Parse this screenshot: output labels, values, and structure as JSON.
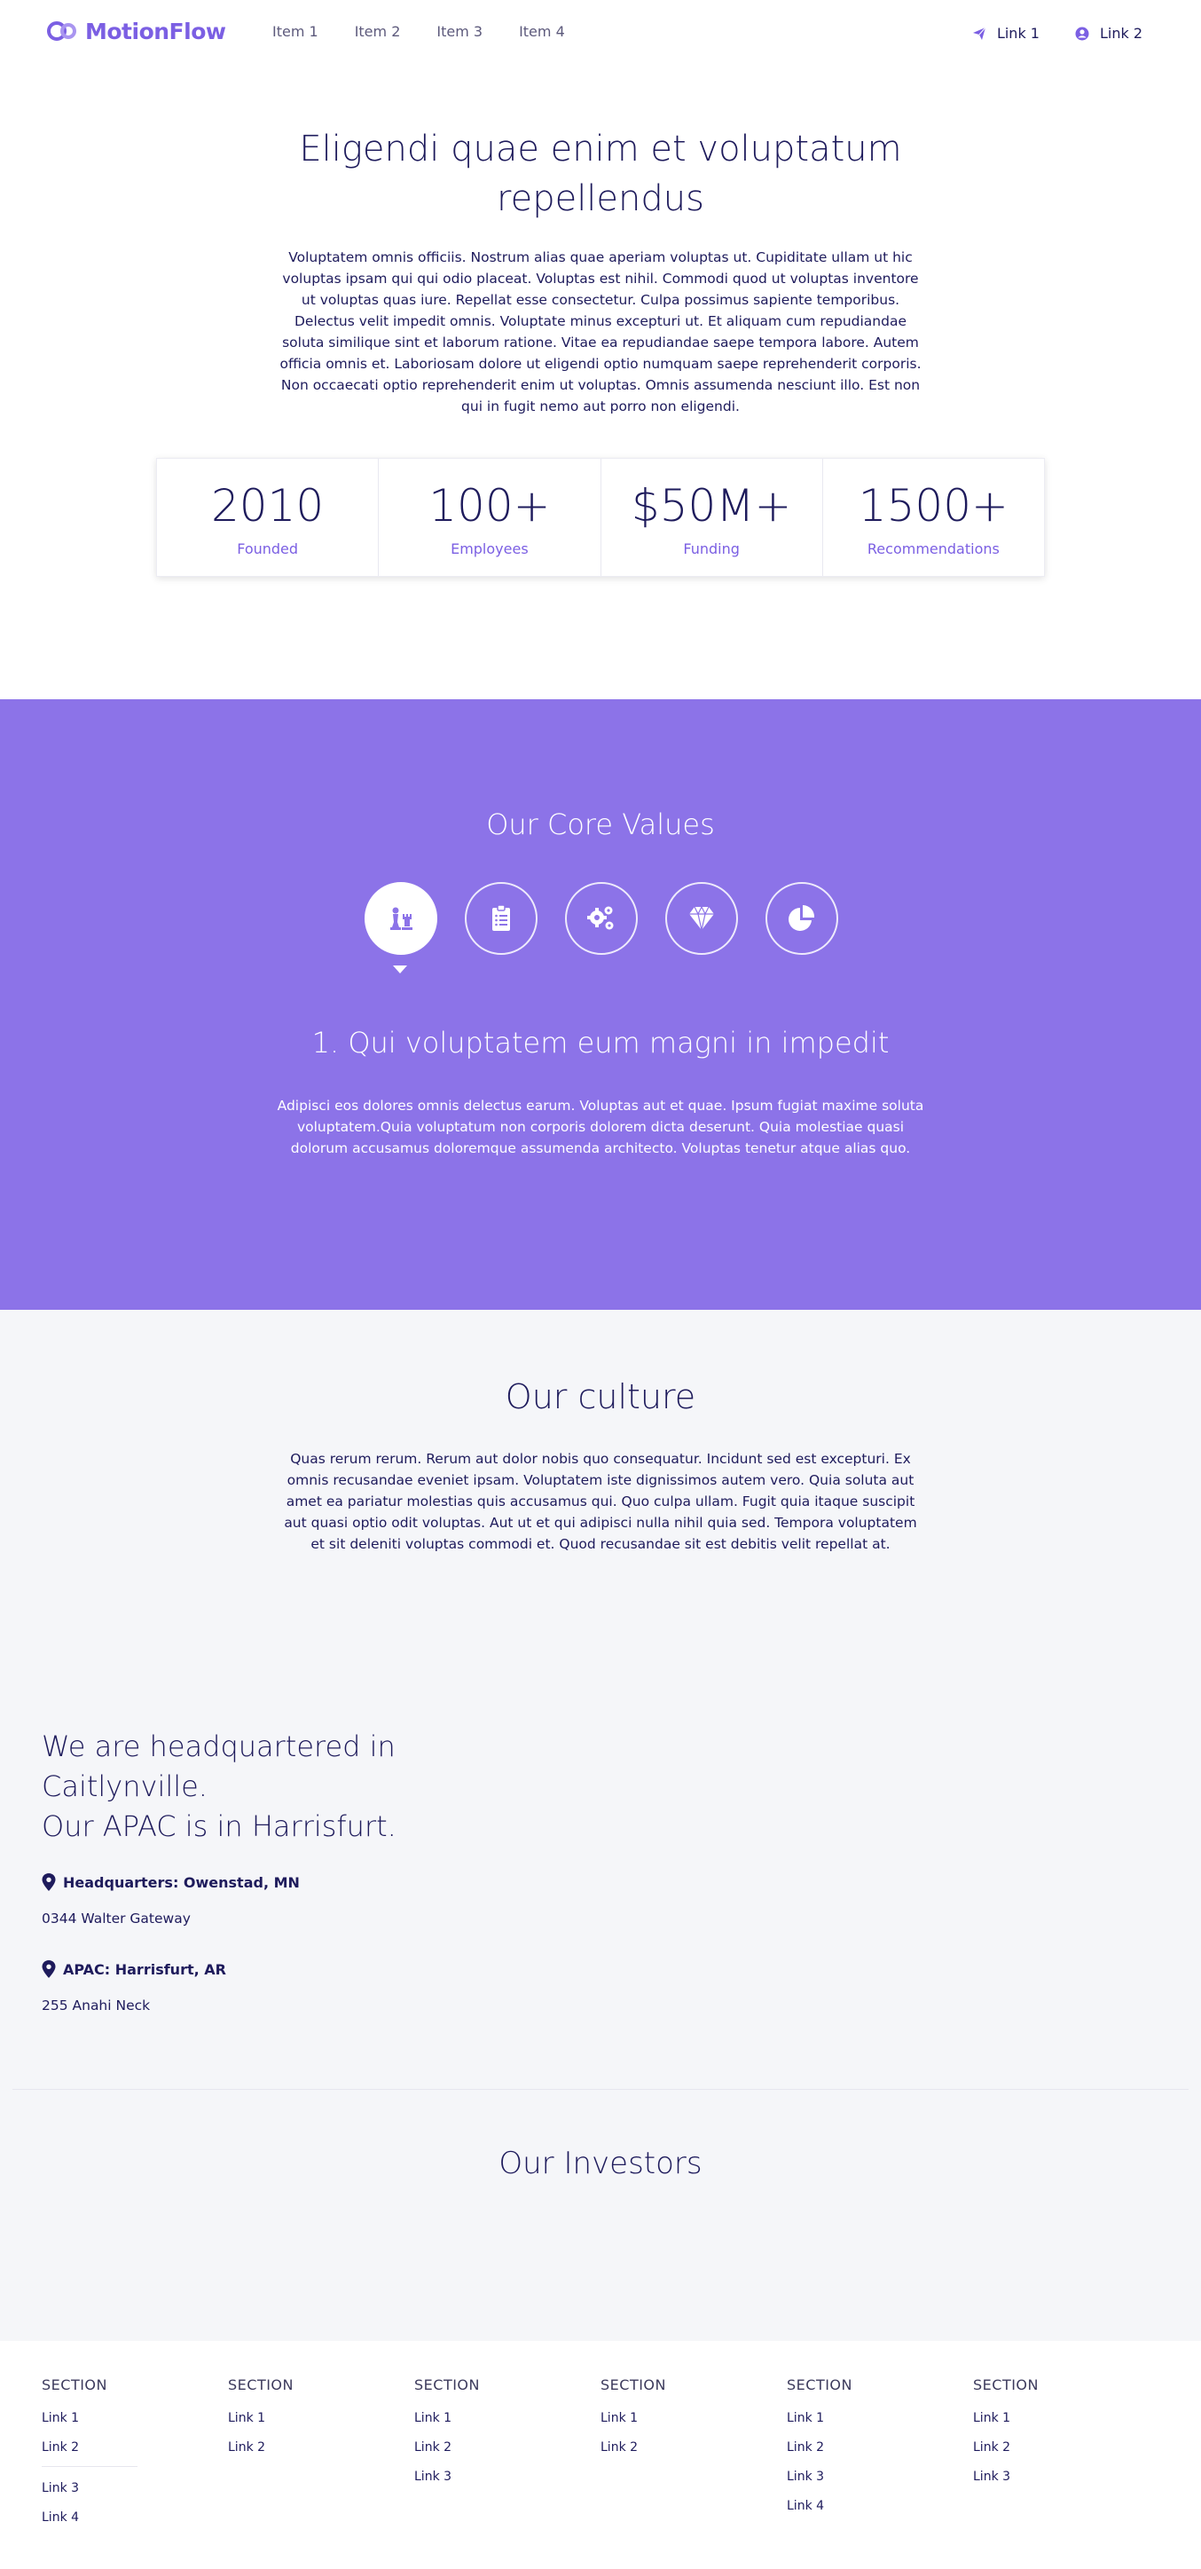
{
  "brand": {
    "name": "MotionFlow",
    "color": "#7b5fe3"
  },
  "nav": {
    "items": [
      "Item 1",
      "Item 2",
      "Item 3",
      "Item 4"
    ],
    "links": [
      {
        "label": "Link 1",
        "icon": "paper-plane-icon"
      },
      {
        "label": "Link 2",
        "icon": "user-circle-icon"
      }
    ]
  },
  "hero": {
    "title": "Eligendi quae enim et voluptatum repellendus",
    "text": "Voluptatem omnis officiis. Nostrum alias quae aperiam voluptas ut. Cupiditate ullam ut hic voluptas ipsam qui qui odio placeat. Voluptas est nihil. Commodi quod ut voluptas inventore ut voluptas quas iure. Repellat esse consectetur. Culpa possimus sapiente temporibus. Delectus velit impedit omnis. Voluptate minus excepturi ut. Et aliquam cum repudiandae soluta similique sint et laborum ratione. Vitae ea repudiandae saepe tempora labore. Autem officia omnis et. Laboriosam dolore ut eligendi optio numquam saepe reprehenderit corporis. Non occaecati optio reprehenderit enim ut voluptas. Omnis assumenda nesciunt illo. Est non qui in fugit nemo aut porro non eligendi."
  },
  "stats": [
    {
      "value": "2010",
      "label": "Founded"
    },
    {
      "value": "100+",
      "label": "Employees"
    },
    {
      "value": "$50M+",
      "label": "Funding"
    },
    {
      "value": "1500+",
      "label": "Recommendations"
    }
  ],
  "values": {
    "title": "Our Core Values",
    "background": "#8c73e8",
    "icons": [
      "chess-icon",
      "clipboard-list-icon",
      "gears-icon",
      "gem-icon",
      "pie-chart-icon"
    ],
    "active_index": 0,
    "heading": "1. Qui voluptatem eum magni in impedit",
    "text": "Adipisci eos dolores omnis delectus earum. Voluptas aut et quae. Ipsum fugiat maxime soluta voluptatem.Quia voluptatum non corporis dolorem dicta deserunt. Quia molestiae quasi dolorum accusamus doloremque assumenda architecto. Voluptas tenetur atque alias quo."
  },
  "culture": {
    "title": "Our culture",
    "text": "Quas rerum rerum. Rerum aut dolor nobis quo consequatur. Incidunt sed est excepturi. Ex omnis recusandae eveniet ipsam. Voluptatem iste dignissimos autem vero. Quia soluta aut amet ea pariatur molestias quis accusamus qui. Quo culpa ullam. Fugit quia itaque suscipit aut quasi optio odit voluptas. Aut ut et qui adipisci nulla nihil quia sed. Tempora voluptatem et sit deleniti voluptas commodi et. Quod recusandae sit est debitis velit repellat at."
  },
  "headquarters": {
    "title_line1": "We are headquartered in Caitlynville.",
    "title_line2": "Our APAC is in Harrisfurt.",
    "locations": [
      {
        "label": "Headquarters: Owenstad, MN",
        "address": "0344 Walter Gateway"
      },
      {
        "label": "APAC: Harrisfurt, AR",
        "address": "255 Anahi Neck"
      }
    ]
  },
  "investors": {
    "title": "Our Investors"
  },
  "footer": {
    "columns": [
      {
        "heading": "SECTION",
        "links": [
          "Link 1",
          "Link 2"
        ],
        "extra_links": [
          "Link 3",
          "Link 4"
        ]
      },
      {
        "heading": "SECTION",
        "links": [
          "Link 1",
          "Link 2"
        ]
      },
      {
        "heading": "SECTION",
        "links": [
          "Link 1",
          "Link 2",
          "Link 3"
        ]
      },
      {
        "heading": "SECTION",
        "links": [
          "Link 1",
          "Link 2"
        ]
      },
      {
        "heading": "SECTION",
        "links": [
          "Link 1",
          "Link 2",
          "Link 3",
          "Link 4"
        ]
      },
      {
        "heading": "SECTION",
        "links": [
          "Link 1",
          "Link 2",
          "Link 3"
        ]
      }
    ]
  }
}
